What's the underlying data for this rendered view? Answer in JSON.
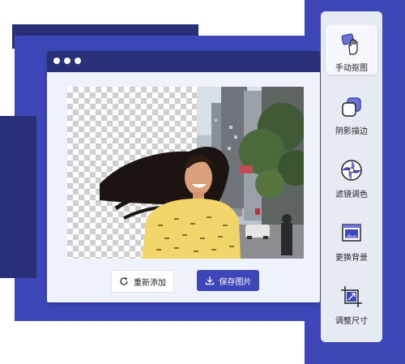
{
  "window": {
    "controls": [
      "close",
      "minimize",
      "maximize"
    ]
  },
  "editor": {
    "canvas_state": "background removed (transparent checkerboard) beside original photo"
  },
  "actions": {
    "readd_label": "重新添加",
    "save_label": "保存图片"
  },
  "tools": [
    {
      "label": "手动抠图",
      "icon": "hand-cutout-icon",
      "active": true
    },
    {
      "label": "阴影描边",
      "icon": "shadow-outline-icon",
      "active": false
    },
    {
      "label": "滤镜调色",
      "icon": "filter-palette-icon",
      "active": false
    },
    {
      "label": "更换背景",
      "icon": "change-background-icon",
      "active": false
    },
    {
      "label": "调整尺寸",
      "icon": "resize-icon",
      "active": false
    }
  ],
  "colors": {
    "accent": "#3d47b8",
    "navy": "#28307a",
    "panel": "#e6eaf3",
    "window_bg": "#eef2fa"
  }
}
